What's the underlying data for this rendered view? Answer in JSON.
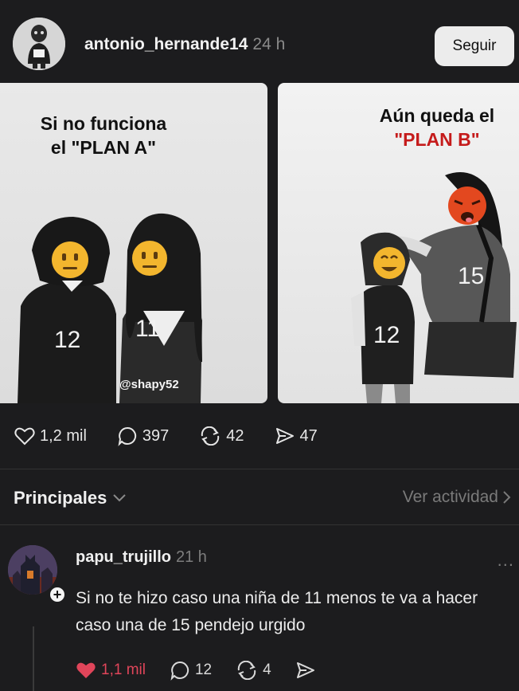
{
  "post": {
    "username": "antonio_hernande14",
    "time": "24 h",
    "follow_label": "Seguir",
    "panel_a": {
      "line1": "Si no funciona",
      "line2": "el \"PLAN A\"",
      "num_left": "12",
      "num_right": "11",
      "watermark": "@shapy52"
    },
    "panel_b": {
      "line1": "Aún queda el",
      "line2": "\"PLAN B\"",
      "num_woman": "15",
      "num_kid": "12"
    },
    "likes": "1,2 mil",
    "comments": "397",
    "reposts": "42",
    "shares": "47"
  },
  "sort": {
    "label": "Principales",
    "activity_label": "Ver actividad"
  },
  "comment": {
    "username": "papu_trujillo",
    "time": "21 h",
    "more": "...",
    "plus": "+",
    "text": "Si no te hizo caso una niña de 11 menos te va a hacer caso una de 15 pendejo urgido",
    "likes": "1,1 mil",
    "replies": "12",
    "reposts": "4"
  },
  "colors": {
    "background": "#1c1c1e",
    "like_red": "#e0455a",
    "plan_b_red": "#c51b1b",
    "follow_bg": "#ececec"
  },
  "icons": [
    "heart-icon",
    "comment-icon",
    "repost-icon",
    "share-icon",
    "chevron-down-icon",
    "chevron-right-icon",
    "more-icon",
    "plus-icon"
  ]
}
